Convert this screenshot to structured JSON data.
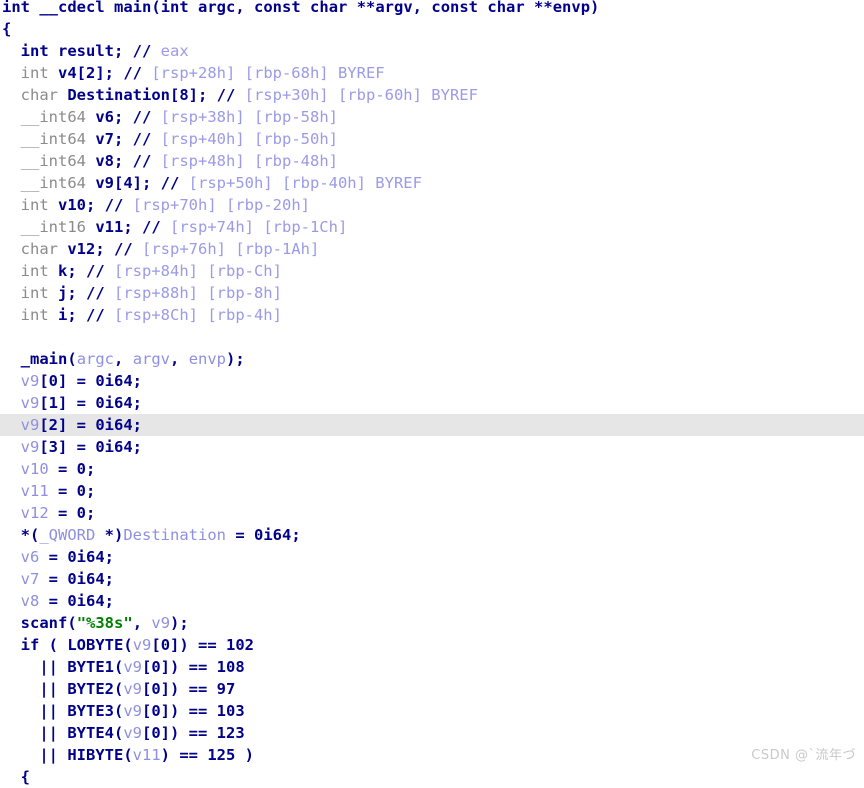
{
  "window": {
    "title": "IDA Pseudocode View",
    "background_color": "#ffffff",
    "highlight_color": "#e6e6e6"
  },
  "theme": {
    "keyword_color": "#00008b",
    "type_color": "#8b8b8b",
    "variable_color": "#8f8fe0",
    "comment_color": "#9a9ae8",
    "string_color": "#008000",
    "number_color": "#00008b"
  },
  "watermark": {
    "text": "CSDN @`流年づ",
    "color": "#c9c9c9"
  },
  "code": {
    "language": "c-pseudocode",
    "function_signature": "int __cdecl main(int argc, const char **argv, const char **envp)",
    "highlighted_line_index": 22,
    "lines": [
      {
        "index": 0,
        "indent": 0,
        "tokens": [
          {
            "t": "int",
            "c": "key"
          },
          {
            "t": " ",
            "c": "plain"
          },
          {
            "t": "__cdecl",
            "c": "key"
          },
          {
            "t": " ",
            "c": "plain"
          },
          {
            "t": "main",
            "c": "func"
          },
          {
            "t": "(",
            "c": "key"
          },
          {
            "t": "int",
            "c": "key"
          },
          {
            "t": " argc, ",
            "c": "key"
          },
          {
            "t": "const",
            "c": "key"
          },
          {
            "t": " ",
            "c": "plain"
          },
          {
            "t": "char",
            "c": "key"
          },
          {
            "t": " **argv, ",
            "c": "key"
          },
          {
            "t": "const",
            "c": "key"
          },
          {
            "t": " ",
            "c": "plain"
          },
          {
            "t": "char",
            "c": "key"
          },
          {
            "t": " **envp)",
            "c": "key"
          }
        ]
      },
      {
        "index": 1,
        "indent": 0,
        "tokens": [
          {
            "t": "{",
            "c": "key"
          }
        ]
      },
      {
        "index": 2,
        "indent": 1,
        "tokens": [
          {
            "t": "int result; ",
            "c": "key"
          },
          {
            "t": "//",
            "c": "cmtmark"
          },
          {
            "t": " eax",
            "c": "cmt"
          }
        ]
      },
      {
        "index": 3,
        "indent": 1,
        "tokens": [
          {
            "t": "int",
            "c": "type"
          },
          {
            "t": " v4[2]; ",
            "c": "key"
          },
          {
            "t": "//",
            "c": "cmtmark"
          },
          {
            "t": " [rsp+28h] [rbp-68h] BYREF",
            "c": "cmt"
          }
        ]
      },
      {
        "index": 4,
        "indent": 1,
        "tokens": [
          {
            "t": "char",
            "c": "type"
          },
          {
            "t": " Destination[8]; ",
            "c": "key"
          },
          {
            "t": "//",
            "c": "cmtmark"
          },
          {
            "t": " [rsp+30h] [rbp-60h] BYREF",
            "c": "cmt"
          }
        ]
      },
      {
        "index": 5,
        "indent": 1,
        "tokens": [
          {
            "t": "__int64",
            "c": "type"
          },
          {
            "t": " v6; ",
            "c": "key"
          },
          {
            "t": "//",
            "c": "cmtmark"
          },
          {
            "t": " [rsp+38h] [rbp-58h]",
            "c": "cmt"
          }
        ]
      },
      {
        "index": 6,
        "indent": 1,
        "tokens": [
          {
            "t": "__int64",
            "c": "type"
          },
          {
            "t": " v7; ",
            "c": "key"
          },
          {
            "t": "//",
            "c": "cmtmark"
          },
          {
            "t": " [rsp+40h] [rbp-50h]",
            "c": "cmt"
          }
        ]
      },
      {
        "index": 7,
        "indent": 1,
        "tokens": [
          {
            "t": "__int64",
            "c": "type"
          },
          {
            "t": " v8; ",
            "c": "key"
          },
          {
            "t": "//",
            "c": "cmtmark"
          },
          {
            "t": " [rsp+48h] [rbp-48h]",
            "c": "cmt"
          }
        ]
      },
      {
        "index": 8,
        "indent": 1,
        "tokens": [
          {
            "t": "__int64",
            "c": "type"
          },
          {
            "t": " v9[4]; ",
            "c": "key"
          },
          {
            "t": "//",
            "c": "cmtmark"
          },
          {
            "t": " [rsp+50h] [rbp-40h] BYREF",
            "c": "cmt"
          }
        ]
      },
      {
        "index": 9,
        "indent": 1,
        "tokens": [
          {
            "t": "int",
            "c": "type"
          },
          {
            "t": " v10; ",
            "c": "key"
          },
          {
            "t": "//",
            "c": "cmtmark"
          },
          {
            "t": " [rsp+70h] [rbp-20h]",
            "c": "cmt"
          }
        ]
      },
      {
        "index": 10,
        "indent": 1,
        "tokens": [
          {
            "t": "__int16",
            "c": "type"
          },
          {
            "t": " v11; ",
            "c": "key"
          },
          {
            "t": "//",
            "c": "cmtmark"
          },
          {
            "t": " [rsp+74h] [rbp-1Ch]",
            "c": "cmt"
          }
        ]
      },
      {
        "index": 11,
        "indent": 1,
        "tokens": [
          {
            "t": "char",
            "c": "type"
          },
          {
            "t": " v12; ",
            "c": "key"
          },
          {
            "t": "//",
            "c": "cmtmark"
          },
          {
            "t": " [rsp+76h] [rbp-1Ah]",
            "c": "cmt"
          }
        ]
      },
      {
        "index": 12,
        "indent": 1,
        "tokens": [
          {
            "t": "int",
            "c": "type"
          },
          {
            "t": " k; ",
            "c": "key"
          },
          {
            "t": "//",
            "c": "cmtmark"
          },
          {
            "t": " [rsp+84h] [rbp-Ch]",
            "c": "cmt"
          }
        ]
      },
      {
        "index": 13,
        "indent": 1,
        "tokens": [
          {
            "t": "int",
            "c": "type"
          },
          {
            "t": " j; ",
            "c": "key"
          },
          {
            "t": "//",
            "c": "cmtmark"
          },
          {
            "t": " [rsp+88h] [rbp-8h]",
            "c": "cmt"
          }
        ]
      },
      {
        "index": 14,
        "indent": 1,
        "tokens": [
          {
            "t": "int",
            "c": "type"
          },
          {
            "t": " i; ",
            "c": "key"
          },
          {
            "t": "//",
            "c": "cmtmark"
          },
          {
            "t": " [rsp+8Ch] [rbp-4h]",
            "c": "cmt"
          }
        ]
      },
      {
        "index": 15,
        "indent": 0,
        "tokens": [
          {
            "t": " ",
            "c": "plain"
          }
        ]
      },
      {
        "index": 16,
        "indent": 1,
        "tokens": [
          {
            "t": "_main",
            "c": "func"
          },
          {
            "t": "(",
            "c": "key"
          },
          {
            "t": "argc",
            "c": "var"
          },
          {
            "t": ", ",
            "c": "key"
          },
          {
            "t": "argv",
            "c": "var"
          },
          {
            "t": ", ",
            "c": "key"
          },
          {
            "t": "envp",
            "c": "var"
          },
          {
            "t": ");",
            "c": "key"
          }
        ]
      },
      {
        "index": 17,
        "indent": 1,
        "tokens": [
          {
            "t": "v9",
            "c": "var"
          },
          {
            "t": "[0] = ",
            "c": "key"
          },
          {
            "t": "0i64",
            "c": "num"
          },
          {
            "t": ";",
            "c": "key"
          }
        ]
      },
      {
        "index": 18,
        "indent": 1,
        "tokens": [
          {
            "t": "v9",
            "c": "var"
          },
          {
            "t": "[1] = ",
            "c": "key"
          },
          {
            "t": "0i64",
            "c": "num"
          },
          {
            "t": ";",
            "c": "key"
          }
        ]
      },
      {
        "index": 19,
        "indent": 1,
        "highlighted": true,
        "tokens": [
          {
            "t": "v9",
            "c": "var"
          },
          {
            "t": "[2] = ",
            "c": "key"
          },
          {
            "t": "0i64",
            "c": "num"
          },
          {
            "t": ";",
            "c": "key"
          }
        ]
      },
      {
        "index": 20,
        "indent": 1,
        "tokens": [
          {
            "t": "v9",
            "c": "var"
          },
          {
            "t": "[3] = ",
            "c": "key"
          },
          {
            "t": "0i64",
            "c": "num"
          },
          {
            "t": ";",
            "c": "key"
          }
        ]
      },
      {
        "index": 21,
        "indent": 1,
        "tokens": [
          {
            "t": "v10",
            "c": "var"
          },
          {
            "t": " = ",
            "c": "key"
          },
          {
            "t": "0",
            "c": "num"
          },
          {
            "t": ";",
            "c": "key"
          }
        ]
      },
      {
        "index": 22,
        "indent": 1,
        "tokens": [
          {
            "t": "v11",
            "c": "var"
          },
          {
            "t": " = ",
            "c": "key"
          },
          {
            "t": "0",
            "c": "num"
          },
          {
            "t": ";",
            "c": "key"
          }
        ]
      },
      {
        "index": 23,
        "indent": 1,
        "tokens": [
          {
            "t": "v12",
            "c": "var"
          },
          {
            "t": " = ",
            "c": "key"
          },
          {
            "t": "0",
            "c": "num"
          },
          {
            "t": ";",
            "c": "key"
          }
        ]
      },
      {
        "index": 24,
        "indent": 1,
        "tokens": [
          {
            "t": "*(",
            "c": "key"
          },
          {
            "t": "_QWORD",
            "c": "macro"
          },
          {
            "t": " *)",
            "c": "key"
          },
          {
            "t": "Destination",
            "c": "macro"
          },
          {
            "t": " = ",
            "c": "key"
          },
          {
            "t": "0i64",
            "c": "num"
          },
          {
            "t": ";",
            "c": "key"
          }
        ]
      },
      {
        "index": 25,
        "indent": 1,
        "tokens": [
          {
            "t": "v6",
            "c": "var"
          },
          {
            "t": " = ",
            "c": "key"
          },
          {
            "t": "0i64",
            "c": "num"
          },
          {
            "t": ";",
            "c": "key"
          }
        ]
      },
      {
        "index": 26,
        "indent": 1,
        "tokens": [
          {
            "t": "v7",
            "c": "var"
          },
          {
            "t": " = ",
            "c": "key"
          },
          {
            "t": "0i64",
            "c": "num"
          },
          {
            "t": ";",
            "c": "key"
          }
        ]
      },
      {
        "index": 27,
        "indent": 1,
        "tokens": [
          {
            "t": "v8",
            "c": "var"
          },
          {
            "t": " = ",
            "c": "key"
          },
          {
            "t": "0i64",
            "c": "num"
          },
          {
            "t": ";",
            "c": "key"
          }
        ]
      },
      {
        "index": 28,
        "indent": 1,
        "tokens": [
          {
            "t": "scanf",
            "c": "func"
          },
          {
            "t": "(",
            "c": "key"
          },
          {
            "t": "\"%38s\"",
            "c": "str"
          },
          {
            "t": ", ",
            "c": "key"
          },
          {
            "t": "v9",
            "c": "var"
          },
          {
            "t": ");",
            "c": "key"
          }
        ]
      },
      {
        "index": 29,
        "indent": 1,
        "tokens": [
          {
            "t": "if ( ",
            "c": "key"
          },
          {
            "t": "LOBYTE",
            "c": "func"
          },
          {
            "t": "(",
            "c": "key"
          },
          {
            "t": "v9",
            "c": "var"
          },
          {
            "t": "[0]) == ",
            "c": "key"
          },
          {
            "t": "102",
            "c": "num"
          }
        ]
      },
      {
        "index": 30,
        "indent": 2,
        "tokens": [
          {
            "t": "|| ",
            "c": "key"
          },
          {
            "t": "BYTE1",
            "c": "func"
          },
          {
            "t": "(",
            "c": "key"
          },
          {
            "t": "v9",
            "c": "var"
          },
          {
            "t": "[0]) == ",
            "c": "key"
          },
          {
            "t": "108",
            "c": "num"
          }
        ]
      },
      {
        "index": 31,
        "indent": 2,
        "tokens": [
          {
            "t": "|| ",
            "c": "key"
          },
          {
            "t": "BYTE2",
            "c": "func"
          },
          {
            "t": "(",
            "c": "key"
          },
          {
            "t": "v9",
            "c": "var"
          },
          {
            "t": "[0]) == ",
            "c": "key"
          },
          {
            "t": "97",
            "c": "num"
          }
        ]
      },
      {
        "index": 32,
        "indent": 2,
        "tokens": [
          {
            "t": "|| ",
            "c": "key"
          },
          {
            "t": "BYTE3",
            "c": "func"
          },
          {
            "t": "(",
            "c": "key"
          },
          {
            "t": "v9",
            "c": "var"
          },
          {
            "t": "[0]) == ",
            "c": "key"
          },
          {
            "t": "103",
            "c": "num"
          }
        ]
      },
      {
        "index": 33,
        "indent": 2,
        "tokens": [
          {
            "t": "|| ",
            "c": "key"
          },
          {
            "t": "BYTE4",
            "c": "func"
          },
          {
            "t": "(",
            "c": "key"
          },
          {
            "t": "v9",
            "c": "var"
          },
          {
            "t": "[0]) == ",
            "c": "key"
          },
          {
            "t": "123",
            "c": "num"
          }
        ]
      },
      {
        "index": 34,
        "indent": 2,
        "tokens": [
          {
            "t": "|| ",
            "c": "key"
          },
          {
            "t": "HIBYTE",
            "c": "func"
          },
          {
            "t": "(",
            "c": "key"
          },
          {
            "t": "v11",
            "c": "var"
          },
          {
            "t": ") == ",
            "c": "key"
          },
          {
            "t": "125",
            "c": "num"
          },
          {
            "t": " )",
            "c": "key"
          }
        ]
      },
      {
        "index": 35,
        "indent": 1,
        "tokens": [
          {
            "t": "{",
            "c": "key"
          }
        ]
      }
    ]
  }
}
